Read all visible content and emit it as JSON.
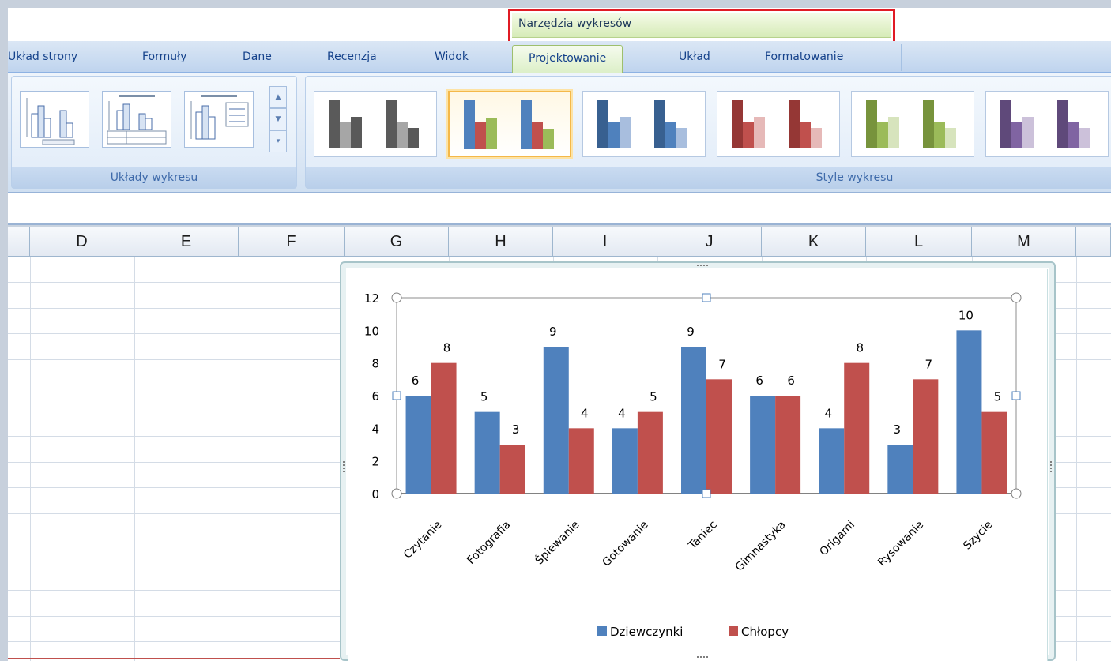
{
  "context_tab": {
    "label": "Narzędzia wykresów"
  },
  "ribbon_tabs": [
    {
      "label": "Układ strony"
    },
    {
      "label": "Formuły"
    },
    {
      "label": "Dane"
    },
    {
      "label": "Recenzja"
    },
    {
      "label": "Widok"
    },
    {
      "label": "Projektowanie",
      "active": true
    },
    {
      "label": "Układ"
    },
    {
      "label": "Formatowanie"
    }
  ],
  "groups": {
    "layouts": {
      "label": "Układy wykresu"
    },
    "styles": {
      "label": "Style wykresu"
    }
  },
  "chart_styles": [
    {
      "name": "gray",
      "colors": [
        "#5a5a5a",
        "#a6a6a6",
        "#595959"
      ]
    },
    {
      "name": "multicolor",
      "colors": [
        "#4f81bd",
        "#c0504d",
        "#9bbb59"
      ],
      "selected": true
    },
    {
      "name": "blue",
      "colors": [
        "#386090",
        "#4f81bd",
        "#a8bede"
      ]
    },
    {
      "name": "red",
      "colors": [
        "#953735",
        "#c0504d",
        "#e6b9b8"
      ]
    },
    {
      "name": "green",
      "colors": [
        "#77933c",
        "#9bbb59",
        "#d7e4bd"
      ]
    },
    {
      "name": "purple",
      "colors": [
        "#5f497a",
        "#8064a2",
        "#ccc1da"
      ]
    }
  ],
  "columns": [
    "D",
    "E",
    "F",
    "G",
    "H",
    "I",
    "J",
    "K",
    "L",
    "M"
  ],
  "colors": {
    "accent_blue": "#4f81bd",
    "accent_red": "#c0504d",
    "highlight": "#e01b24"
  },
  "chart_data": {
    "type": "bar",
    "categories": [
      "Czytanie",
      "Fotografia",
      "Śpiewanie",
      "Gotowanie",
      "Taniec",
      "Gimnastyka",
      "Origami",
      "Rysowanie",
      "Szycie"
    ],
    "series": [
      {
        "name": "Dziewczynki",
        "color": "#4f81bd",
        "values": [
          6,
          5,
          9,
          4,
          9,
          6,
          4,
          3,
          10
        ]
      },
      {
        "name": "Chłopcy",
        "color": "#c0504d",
        "values": [
          8,
          3,
          4,
          5,
          7,
          6,
          8,
          7,
          5
        ]
      }
    ],
    "yticks": [
      "0",
      "2",
      "4",
      "6",
      "8",
      "10",
      "12"
    ],
    "ylim": [
      0,
      12
    ],
    "legend": "bottom",
    "data_labels": true,
    "grid": false
  }
}
